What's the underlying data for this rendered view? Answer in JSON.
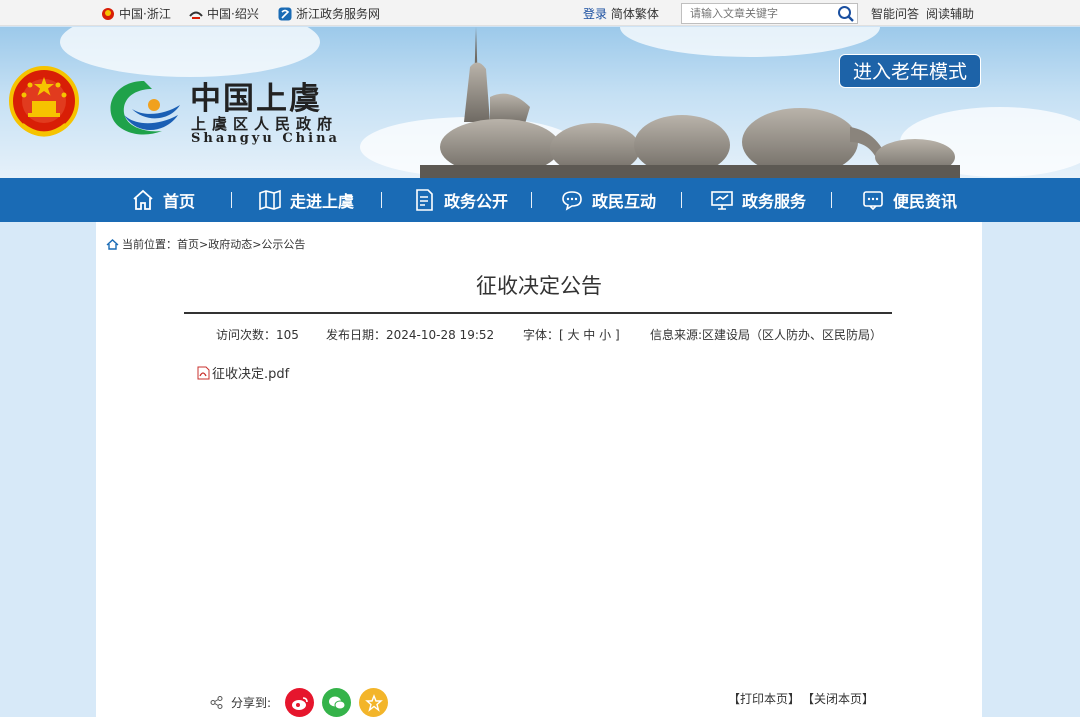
{
  "topbar": {
    "links": [
      "中国·浙江",
      "中国·绍兴",
      "浙江政务服务网"
    ],
    "login": "登录",
    "lang": "简体繁体",
    "search_placeholder": "请输入文章关键字",
    "qa": "智能问答",
    "reading": "阅读辅助"
  },
  "banner": {
    "title_cn": "中国上虞",
    "subtitle_cn": "上虞区人民政府",
    "title_en": "Shangyu  China",
    "elder_mode": "进入老年模式"
  },
  "nav": [
    "首页",
    "走进上虞",
    "政务公开",
    "政民互动",
    "政务服务",
    "便民资讯"
  ],
  "breadcrumb": "当前位置：首页>政府动态>公示公告",
  "article": {
    "title": "征收决定公告",
    "visits": "访问次数：105",
    "date": "发布日期：2024-10-28 19:52",
    "font": "字体：[ 大 中 小 ]",
    "source": "信息来源:区建设局（区人防办、区民防局）",
    "attachment": "征收决定.pdf"
  },
  "footer": {
    "share_label": "分享到:",
    "print": "【打印本页】",
    "close": "【关闭本页】"
  },
  "colors": {
    "nav": "#1a6bb5",
    "elder_btn": "#1d63a8",
    "weibo": "#e6162d",
    "wechat": "#35b34a",
    "favorite": "#f3b52a"
  }
}
